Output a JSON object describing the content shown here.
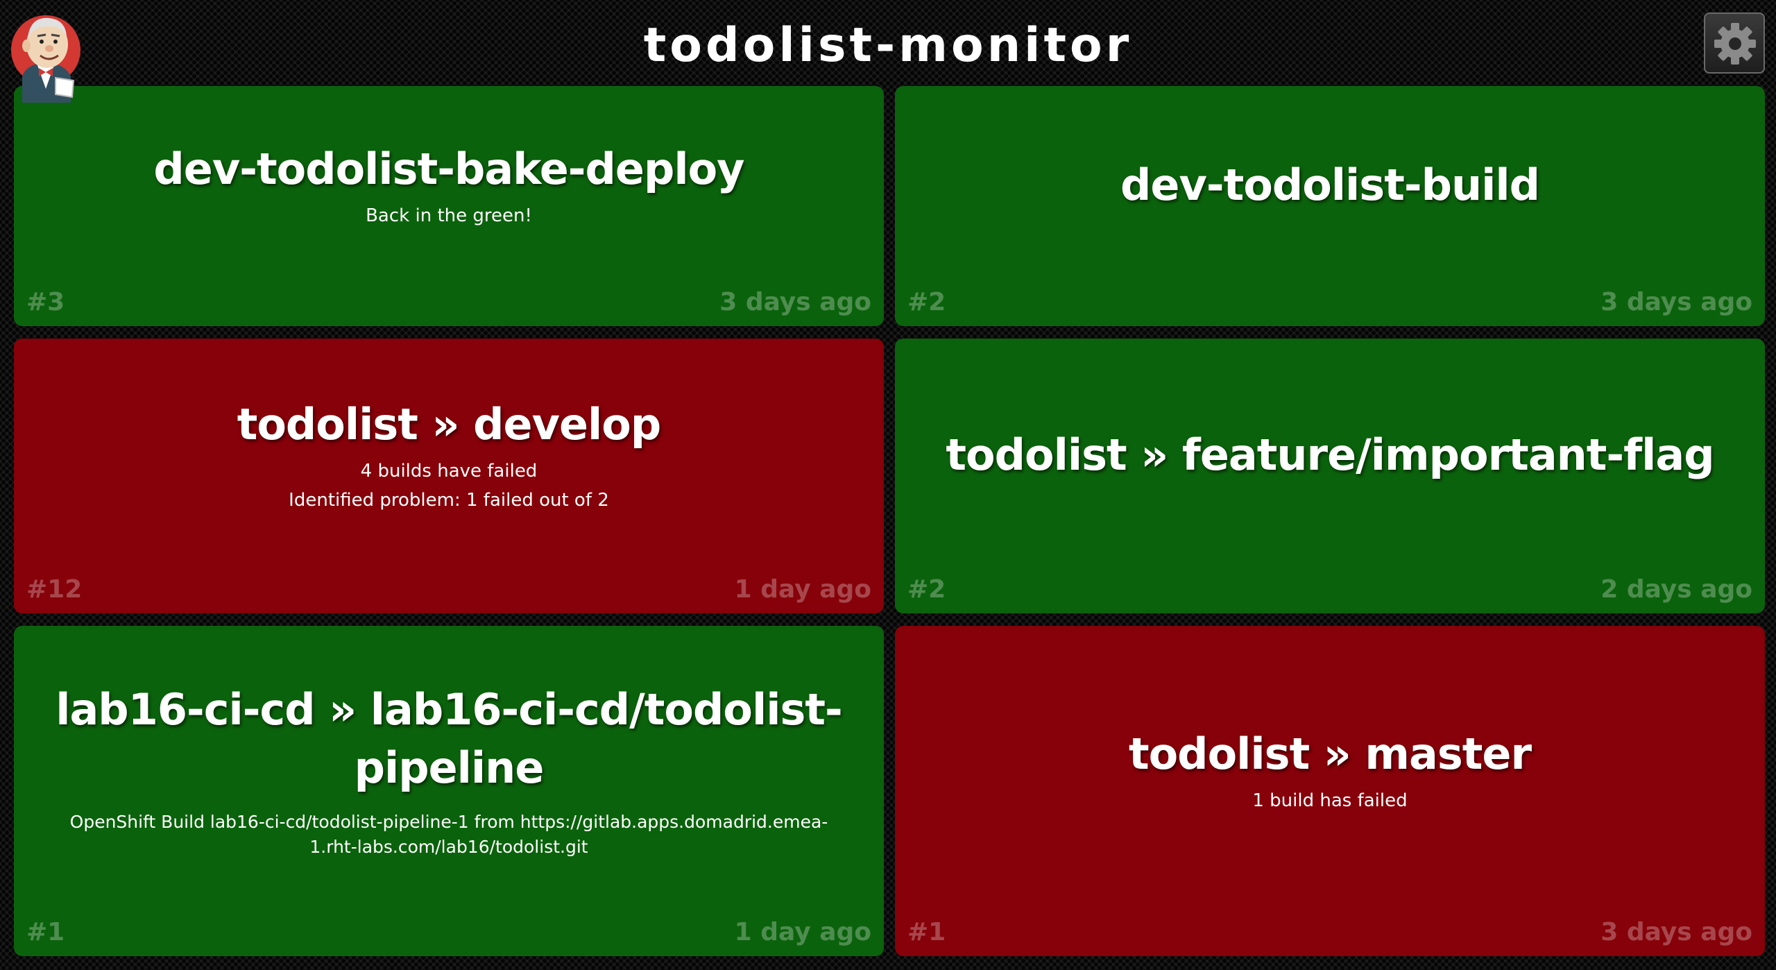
{
  "header": {
    "title": "todolist-monitor",
    "logo_icon": "jenkins-butler-icon",
    "settings_icon": "gear-icon"
  },
  "colors": {
    "success": "#0b620c",
    "failure": "#860109",
    "background": "#1b1b1b"
  },
  "tiles": [
    {
      "name": "dev-todolist-bake-deploy",
      "status": "success",
      "lines": [
        "Back in the green!"
      ],
      "build_number": "#3",
      "time": "3 days ago"
    },
    {
      "name": "dev-todolist-build",
      "status": "success",
      "lines": [],
      "build_number": "#2",
      "time": "3 days ago"
    },
    {
      "name": "todolist » develop",
      "status": "failure",
      "lines": [
        "4 builds have failed",
        "Identified problem: 1 failed out of 2"
      ],
      "build_number": "#12",
      "time": "1 day ago"
    },
    {
      "name": "todolist » feature/important-flag",
      "status": "success",
      "lines": [],
      "build_number": "#2",
      "time": "2 days ago"
    },
    {
      "name": "lab16-ci-cd » lab16-ci-cd/todolist-pipeline",
      "status": "success",
      "lines": [],
      "description": "OpenShift Build lab16-ci-cd/todolist-pipeline-1 from https://gitlab.apps.domadrid.emea-1.rht-labs.com/lab16/todolist.git",
      "build_number": "#1",
      "time": "1 day ago"
    },
    {
      "name": "todolist » master",
      "status": "failure",
      "lines": [
        "1 build has failed"
      ],
      "build_number": "#1",
      "time": "3 days ago"
    }
  ]
}
